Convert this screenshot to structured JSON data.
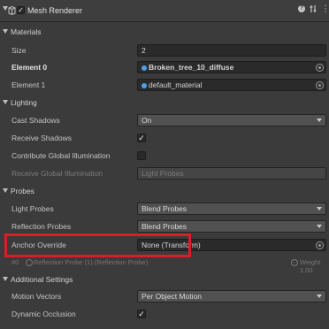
{
  "header": {
    "title": "Mesh Renderer",
    "enabled": "✓",
    "help_icon": "help-icon",
    "presets_icon": "presets-icon",
    "menu_icon": "⋮"
  },
  "materials": {
    "section_label": "Materials",
    "size_label": "Size",
    "size_value": "2",
    "element0_label": "Element 0",
    "element0_value": "Broken_tree_10_diffuse",
    "element1_label": "Element 1",
    "element1_value": "default_material"
  },
  "lighting": {
    "section_label": "Lighting",
    "cast_shadows_label": "Cast Shadows",
    "cast_shadows_value": "On",
    "receive_shadows_label": "Receive Shadows",
    "receive_shadows_check": "✓",
    "contribute_gi_label": "Contribute Global Illumination",
    "receive_gi_label": "Receive Global Illumination",
    "receive_gi_value": "Light Probes"
  },
  "probes": {
    "section_label": "Probes",
    "light_probes_label": "Light Probes",
    "light_probes_value": "Blend Probes",
    "reflection_probes_label": "Reflection Probes",
    "reflection_probes_value": "Blend Probes",
    "anchor_override_label": "Anchor Override",
    "anchor_override_value": "None (Transform)",
    "probe_index": "#0",
    "probe_name": "Reflection Probe (1) (Reflection Probe)",
    "probe_weight": "Weight 1.00"
  },
  "additional": {
    "section_label": "Additional Settings",
    "motion_vectors_label": "Motion Vectors",
    "motion_vectors_value": "Per Object Motion",
    "dynamic_occlusion_label": "Dynamic Occlusion",
    "dynamic_occlusion_check": "✓"
  },
  "colors": {
    "highlight": "#d71f25",
    "background": "#3b3b3b",
    "object_icon": "#4ea1e8"
  }
}
